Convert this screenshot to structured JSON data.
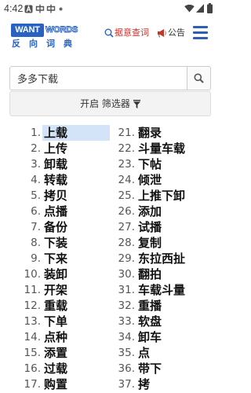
{
  "status_bar": {
    "time": "4:42",
    "notification_icons": [
      "a-icon",
      "app-icon",
      "app-icon",
      "dot-icon"
    ],
    "system_icons": [
      "wifi-icon",
      "signal-icon",
      "battery-icon"
    ]
  },
  "header": {
    "logo": {
      "part1": "WANT",
      "part2": "WORDS",
      "subtitle": "反向词典"
    },
    "search_link": {
      "label": "据意查词",
      "icon": "search-icon"
    },
    "notice_link": {
      "label": "公告",
      "icon": "megaphone-icon"
    },
    "menu_icon": "hamburger-menu-icon"
  },
  "search": {
    "value": "多多下载",
    "button_icon": "search-icon"
  },
  "filter": {
    "label": "开启 筛选器",
    "icon": "filter-icon"
  },
  "results": {
    "selected_rank": 1,
    "left": [
      {
        "rank": "1.",
        "word": "上载"
      },
      {
        "rank": "2.",
        "word": "上传"
      },
      {
        "rank": "3.",
        "word": "卸载"
      },
      {
        "rank": "4.",
        "word": "转载"
      },
      {
        "rank": "5.",
        "word": "拷贝"
      },
      {
        "rank": "6.",
        "word": "点播"
      },
      {
        "rank": "7.",
        "word": "备份"
      },
      {
        "rank": "8.",
        "word": "下装"
      },
      {
        "rank": "9.",
        "word": "下来"
      },
      {
        "rank": "10.",
        "word": "装卸"
      },
      {
        "rank": "11.",
        "word": "开架"
      },
      {
        "rank": "12.",
        "word": "重载"
      },
      {
        "rank": "13.",
        "word": "下单"
      },
      {
        "rank": "14.",
        "word": "点种"
      },
      {
        "rank": "15.",
        "word": "添置"
      },
      {
        "rank": "16.",
        "word": "过载"
      },
      {
        "rank": "17.",
        "word": "购置"
      }
    ],
    "right": [
      {
        "rank": "21.",
        "word": "翻录"
      },
      {
        "rank": "22.",
        "word": "斗量车载"
      },
      {
        "rank": "23.",
        "word": "下帖"
      },
      {
        "rank": "24.",
        "word": "倾泄"
      },
      {
        "rank": "25.",
        "word": "上推下卸"
      },
      {
        "rank": "26.",
        "word": "添加"
      },
      {
        "rank": "27.",
        "word": "试播"
      },
      {
        "rank": "28.",
        "word": "复制"
      },
      {
        "rank": "29.",
        "word": "东拉西扯"
      },
      {
        "rank": "30.",
        "word": "翻拍"
      },
      {
        "rank": "31.",
        "word": "车载斗量"
      },
      {
        "rank": "32.",
        "word": "重播"
      },
      {
        "rank": "33.",
        "word": "软盘"
      },
      {
        "rank": "34.",
        "word": "卸车"
      },
      {
        "rank": "35.",
        "word": "点"
      },
      {
        "rank": "36.",
        "word": "带下"
      },
      {
        "rank": "37.",
        "word": "拷"
      }
    ]
  },
  "colors": {
    "brand_blue": "#2a62c4",
    "link_red": "#d6302b",
    "selection": "#d3e4f8",
    "rank_gray": "#555555"
  }
}
